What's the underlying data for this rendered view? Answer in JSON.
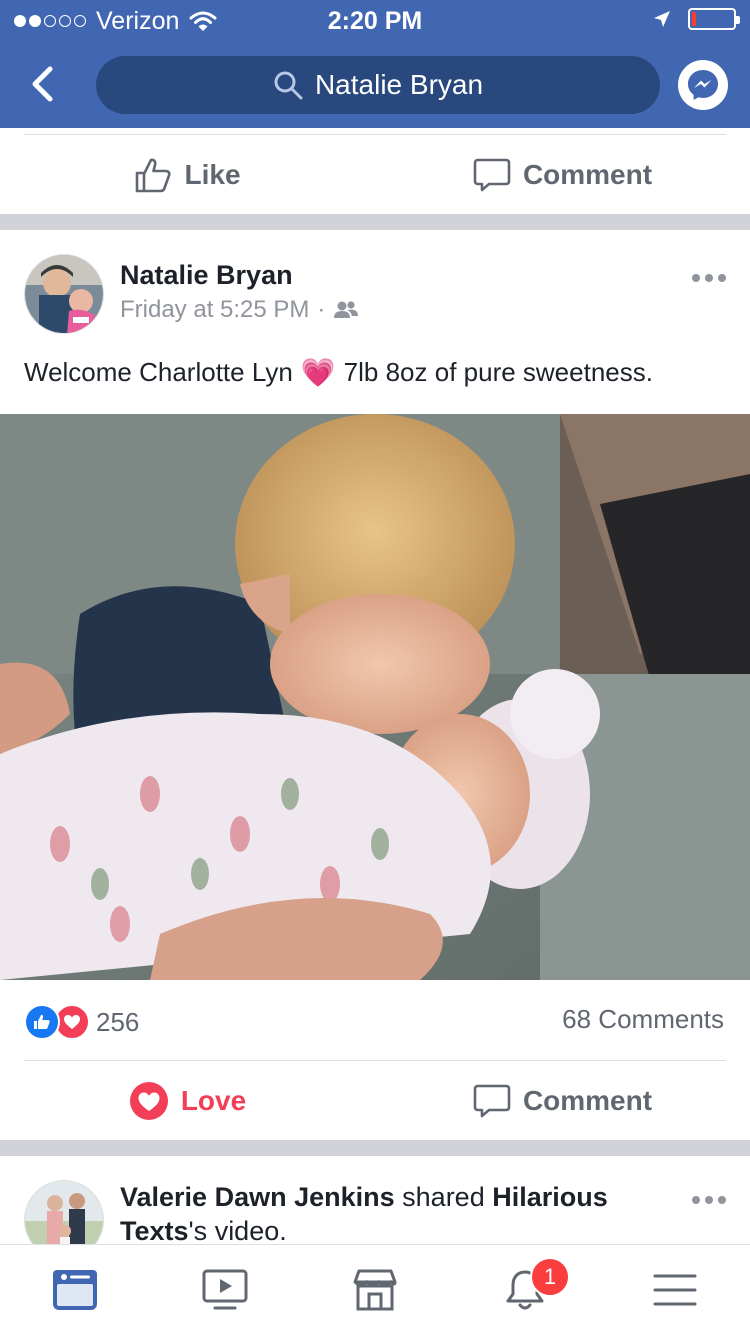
{
  "status_bar": {
    "carrier": "Verizon",
    "signal_bars_filled": 2,
    "signal_bars_total": 5,
    "time": "2:20 PM",
    "battery_level": 0.1
  },
  "header": {
    "search_text": "Natalie Bryan"
  },
  "top_actions": {
    "like_label": "Like",
    "comment_label": "Comment"
  },
  "post": {
    "author": "Natalie Bryan",
    "timestamp": "Friday at 5:25 PM",
    "separator": "·",
    "audience_icon": "friends-icon",
    "text_before": "Welcome Charlotte Lyn",
    "text_emoji": "💗",
    "text_after": "7lb 8oz of pure sweetness.",
    "reaction_count": "256",
    "comments_count": "68 Comments",
    "love_label": "Love",
    "comment_label": "Comment"
  },
  "next_post": {
    "author": "Valerie Dawn Jenkins",
    "verb": "shared",
    "page": "Hilarious Texts",
    "suffix": "'s video."
  },
  "tabbar": {
    "notification_badge": "1"
  },
  "colors": {
    "brand_blue": "#4267b2",
    "search_bg": "#29487d",
    "love_red": "#f33e58",
    "like_blue": "#1877f2"
  }
}
